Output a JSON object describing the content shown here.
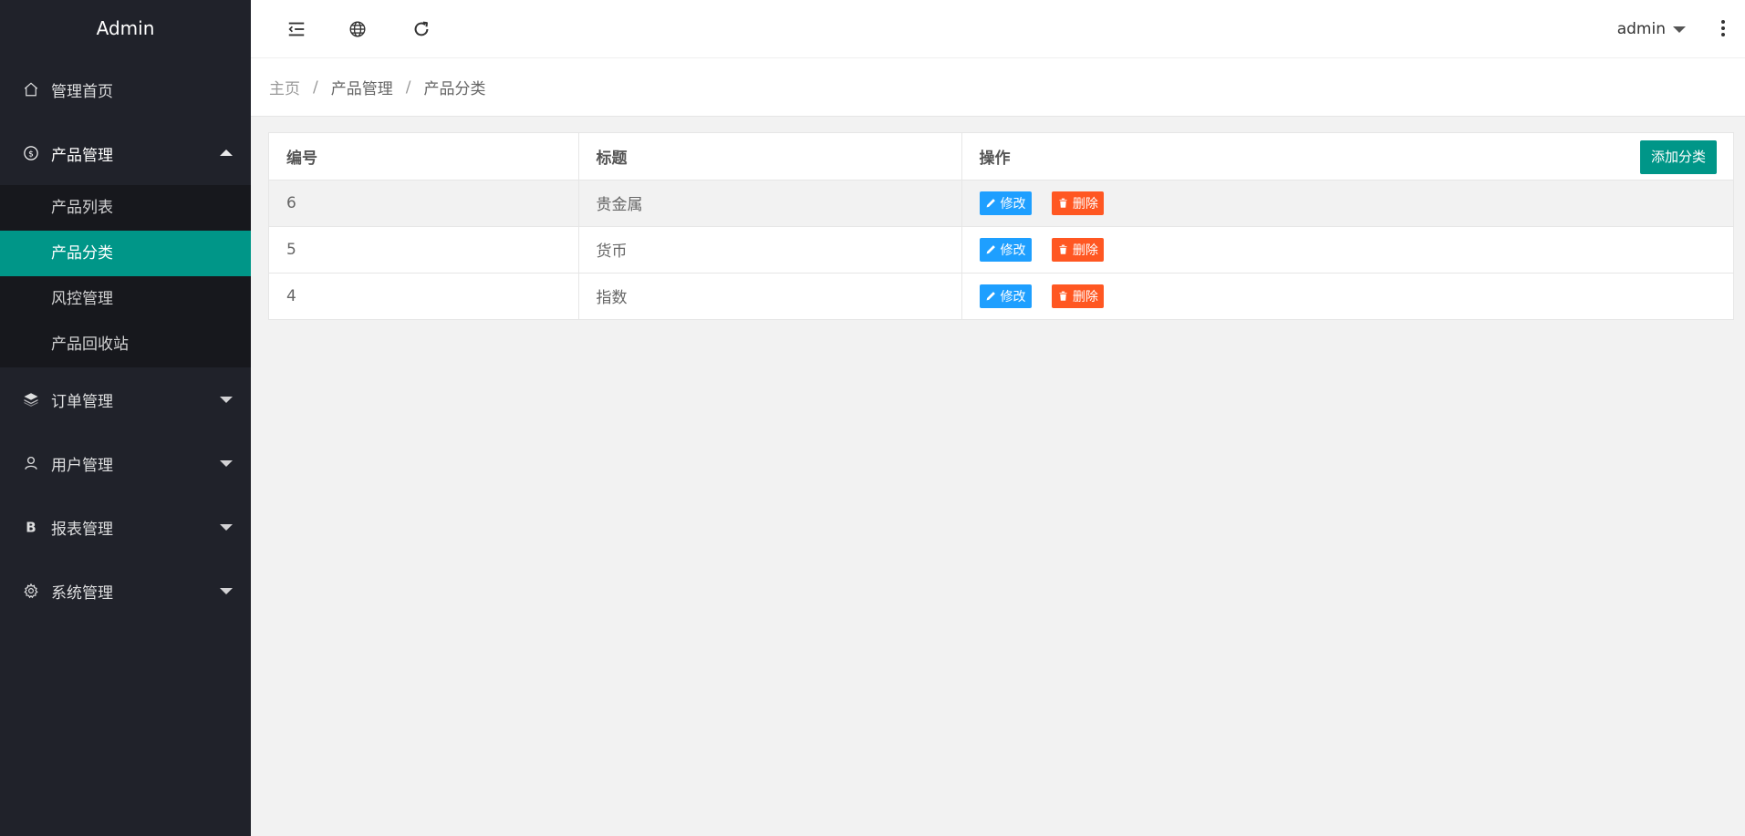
{
  "app": {
    "title": "Admin"
  },
  "sidebar": {
    "items": [
      {
        "label": "管理首页",
        "icon": "home-icon"
      },
      {
        "label": "产品管理",
        "icon": "dollar-icon",
        "expanded": true,
        "children": [
          {
            "label": "产品列表"
          },
          {
            "label": "产品分类",
            "active": true
          },
          {
            "label": "风控管理"
          },
          {
            "label": "产品回收站"
          }
        ]
      },
      {
        "label": "订单管理",
        "icon": "layers-icon"
      },
      {
        "label": "用户管理",
        "icon": "user-icon"
      },
      {
        "label": "报表管理",
        "icon": "bold-b-icon"
      },
      {
        "label": "系统管理",
        "icon": "gear-icon"
      }
    ]
  },
  "header": {
    "icons": [
      "menu-collapse-icon",
      "globe-icon",
      "refresh-icon",
      "more-vertical-icon"
    ],
    "user": "admin"
  },
  "breadcrumb": [
    "主页",
    "产品管理",
    "产品分类"
  ],
  "table": {
    "columns": [
      "编号",
      "标题",
      "操作"
    ],
    "add_button": "添加分类",
    "rows": [
      {
        "id": "6",
        "title": "贵金属"
      },
      {
        "id": "5",
        "title": "货币"
      },
      {
        "id": "4",
        "title": "指数"
      }
    ],
    "edit_label": "修改",
    "delete_label": "删除"
  },
  "colors": {
    "sidebar_bg": "#20222a",
    "accent": "#009688",
    "edit": "#1e9fff",
    "delete": "#ff5722"
  }
}
